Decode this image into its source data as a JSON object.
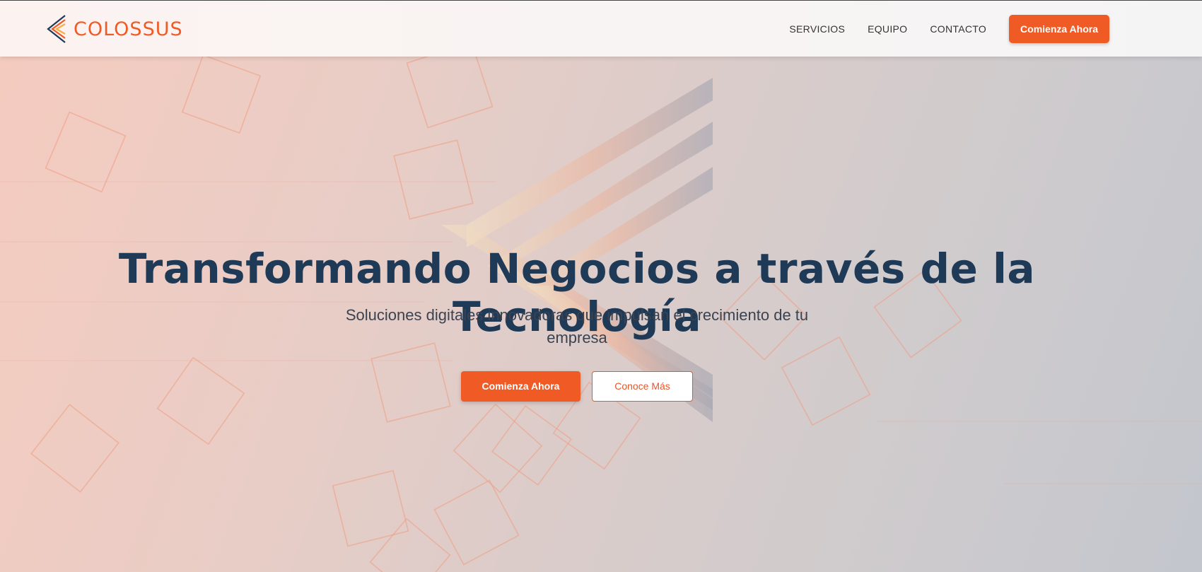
{
  "brand": {
    "name": "COLOSSUS",
    "color": "#f05a24",
    "logo_icon": "chevron-logo-icon"
  },
  "nav": {
    "items": [
      {
        "label": "SERVICIOS"
      },
      {
        "label": "EQUIPO"
      },
      {
        "label": "CONTACTO"
      }
    ],
    "cta_label": "Comienza Ahora"
  },
  "hero": {
    "title": "Transformando Negocios a través de la Tecnología",
    "subtitle": "Soluciones digitales innovadoras que impulsan el crecimiento de tu empresa",
    "primary_button": "Comienza Ahora",
    "secondary_button": "Conoce Más"
  },
  "colors": {
    "accent": "#f05a24",
    "heading": "#1f3a56",
    "text": "#3b4250"
  }
}
